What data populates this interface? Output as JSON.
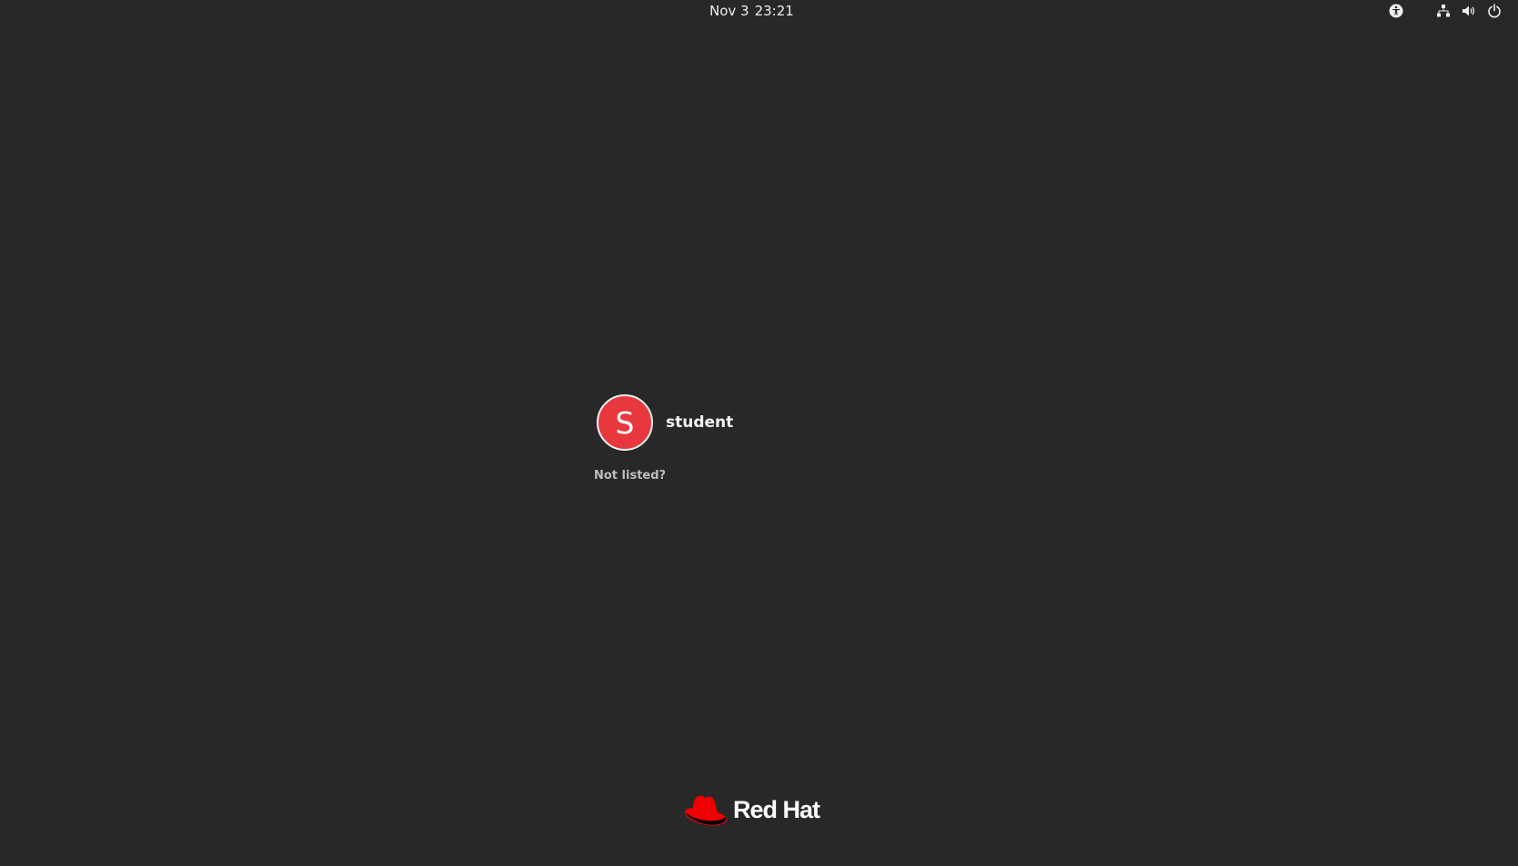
{
  "top_bar": {
    "date": "Nov 3",
    "time": "23:21",
    "icons": [
      "accessibility-icon",
      "network-wired-icon",
      "volume-icon",
      "power-icon"
    ]
  },
  "login": {
    "users": [
      {
        "initial": "S",
        "name": "student",
        "avatar_color": "#e8383d"
      }
    ],
    "not_listed_label": "Not listed?"
  },
  "branding": {
    "logo_text": "Red Hat",
    "logo_color": "#ee0000"
  },
  "colors": {
    "background": "#282828",
    "text": "#f2f2f2",
    "muted_text": "#bdbdbd"
  }
}
